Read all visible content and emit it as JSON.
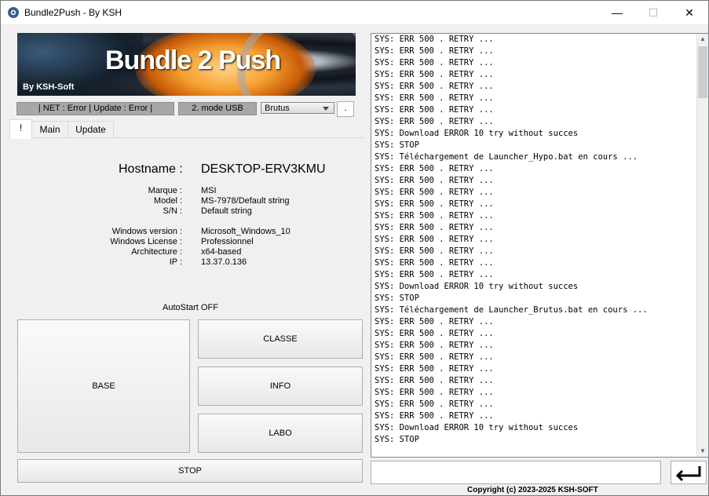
{
  "window": {
    "title": "Bundle2Push - By KSH",
    "min_glyph": "—",
    "max_glyph": "☐",
    "close_glyph": "✕"
  },
  "banner": {
    "title": "Bundle 2 Push",
    "subtitle": "By KSH-Soft"
  },
  "status": {
    "net_update": "| NET : Error | Update : Error |",
    "mode": "2. mode USB",
    "profile_selected": "Brutus",
    "dot_button": "."
  },
  "tabs": [
    {
      "label": "!"
    },
    {
      "label": "Main"
    },
    {
      "label": "Update"
    }
  ],
  "system": {
    "hostname_label": "Hostname :",
    "hostname": "DESKTOP-ERV3KMU",
    "rows": [
      {
        "label": "Marque :",
        "value": "MSI"
      },
      {
        "label": "Model :",
        "value": "MS-7978/Default string"
      },
      {
        "label": "S/N :",
        "value": "Default string"
      },
      {
        "label": "Windows version :",
        "value": "Microsoft_Windows_10"
      },
      {
        "label": "Windows License :",
        "value": "Professionnel"
      },
      {
        "label": "Architecture :",
        "value": "x64-based"
      },
      {
        "label": "IP :",
        "value": "13.37.0.136"
      }
    ]
  },
  "autostart": "AutoStart OFF",
  "buttons": {
    "base": "BASE",
    "classe": "CLASSE",
    "info": "INFO",
    "labo": "LABO",
    "stop": "STOP"
  },
  "log": [
    "SYS: ERR 500 . RETRY ...",
    "SYS: ERR 500 . RETRY ...",
    "SYS: ERR 500 . RETRY ...",
    "SYS: ERR 500 . RETRY ...",
    "SYS: ERR 500 . RETRY ...",
    "SYS: ERR 500 . RETRY ...",
    "SYS: ERR 500 . RETRY ...",
    "SYS: ERR 500 . RETRY ...",
    "SYS: Download ERROR 10 try without succes",
    "SYS: STOP",
    "SYS: Téléchargement de Launcher_Hypo.bat en cours ...",
    "SYS: ERR 500 . RETRY ...",
    "SYS: ERR 500 . RETRY ...",
    "SYS: ERR 500 . RETRY ...",
    "SYS: ERR 500 . RETRY ...",
    "SYS: ERR 500 . RETRY ...",
    "SYS: ERR 500 . RETRY ...",
    "SYS: ERR 500 . RETRY ...",
    "SYS: ERR 500 . RETRY ...",
    "SYS: ERR 500 . RETRY ...",
    "SYS: ERR 500 . RETRY ...",
    "SYS: Download ERROR 10 try without succes",
    "SYS: STOP",
    "SYS: Téléchargement de Launcher_Brutus.bat en cours ...",
    "SYS: ERR 500 . RETRY ...",
    "SYS: ERR 500 . RETRY ...",
    "SYS: ERR 500 . RETRY ...",
    "SYS: ERR 500 . RETRY ...",
    "SYS: ERR 500 . RETRY ...",
    "SYS: ERR 500 . RETRY ...",
    "SYS: ERR 500 . RETRY ...",
    "SYS: ERR 500 . RETRY ...",
    "SYS: ERR 500 . RETRY ...",
    "SYS: Download ERROR 10 try without succes",
    "SYS: STOP"
  ],
  "command_input": {
    "value": ""
  },
  "enter_icon": "return-arrow-icon",
  "copyright": "Copyright (c) 2023-2025 KSH-SOFT"
}
